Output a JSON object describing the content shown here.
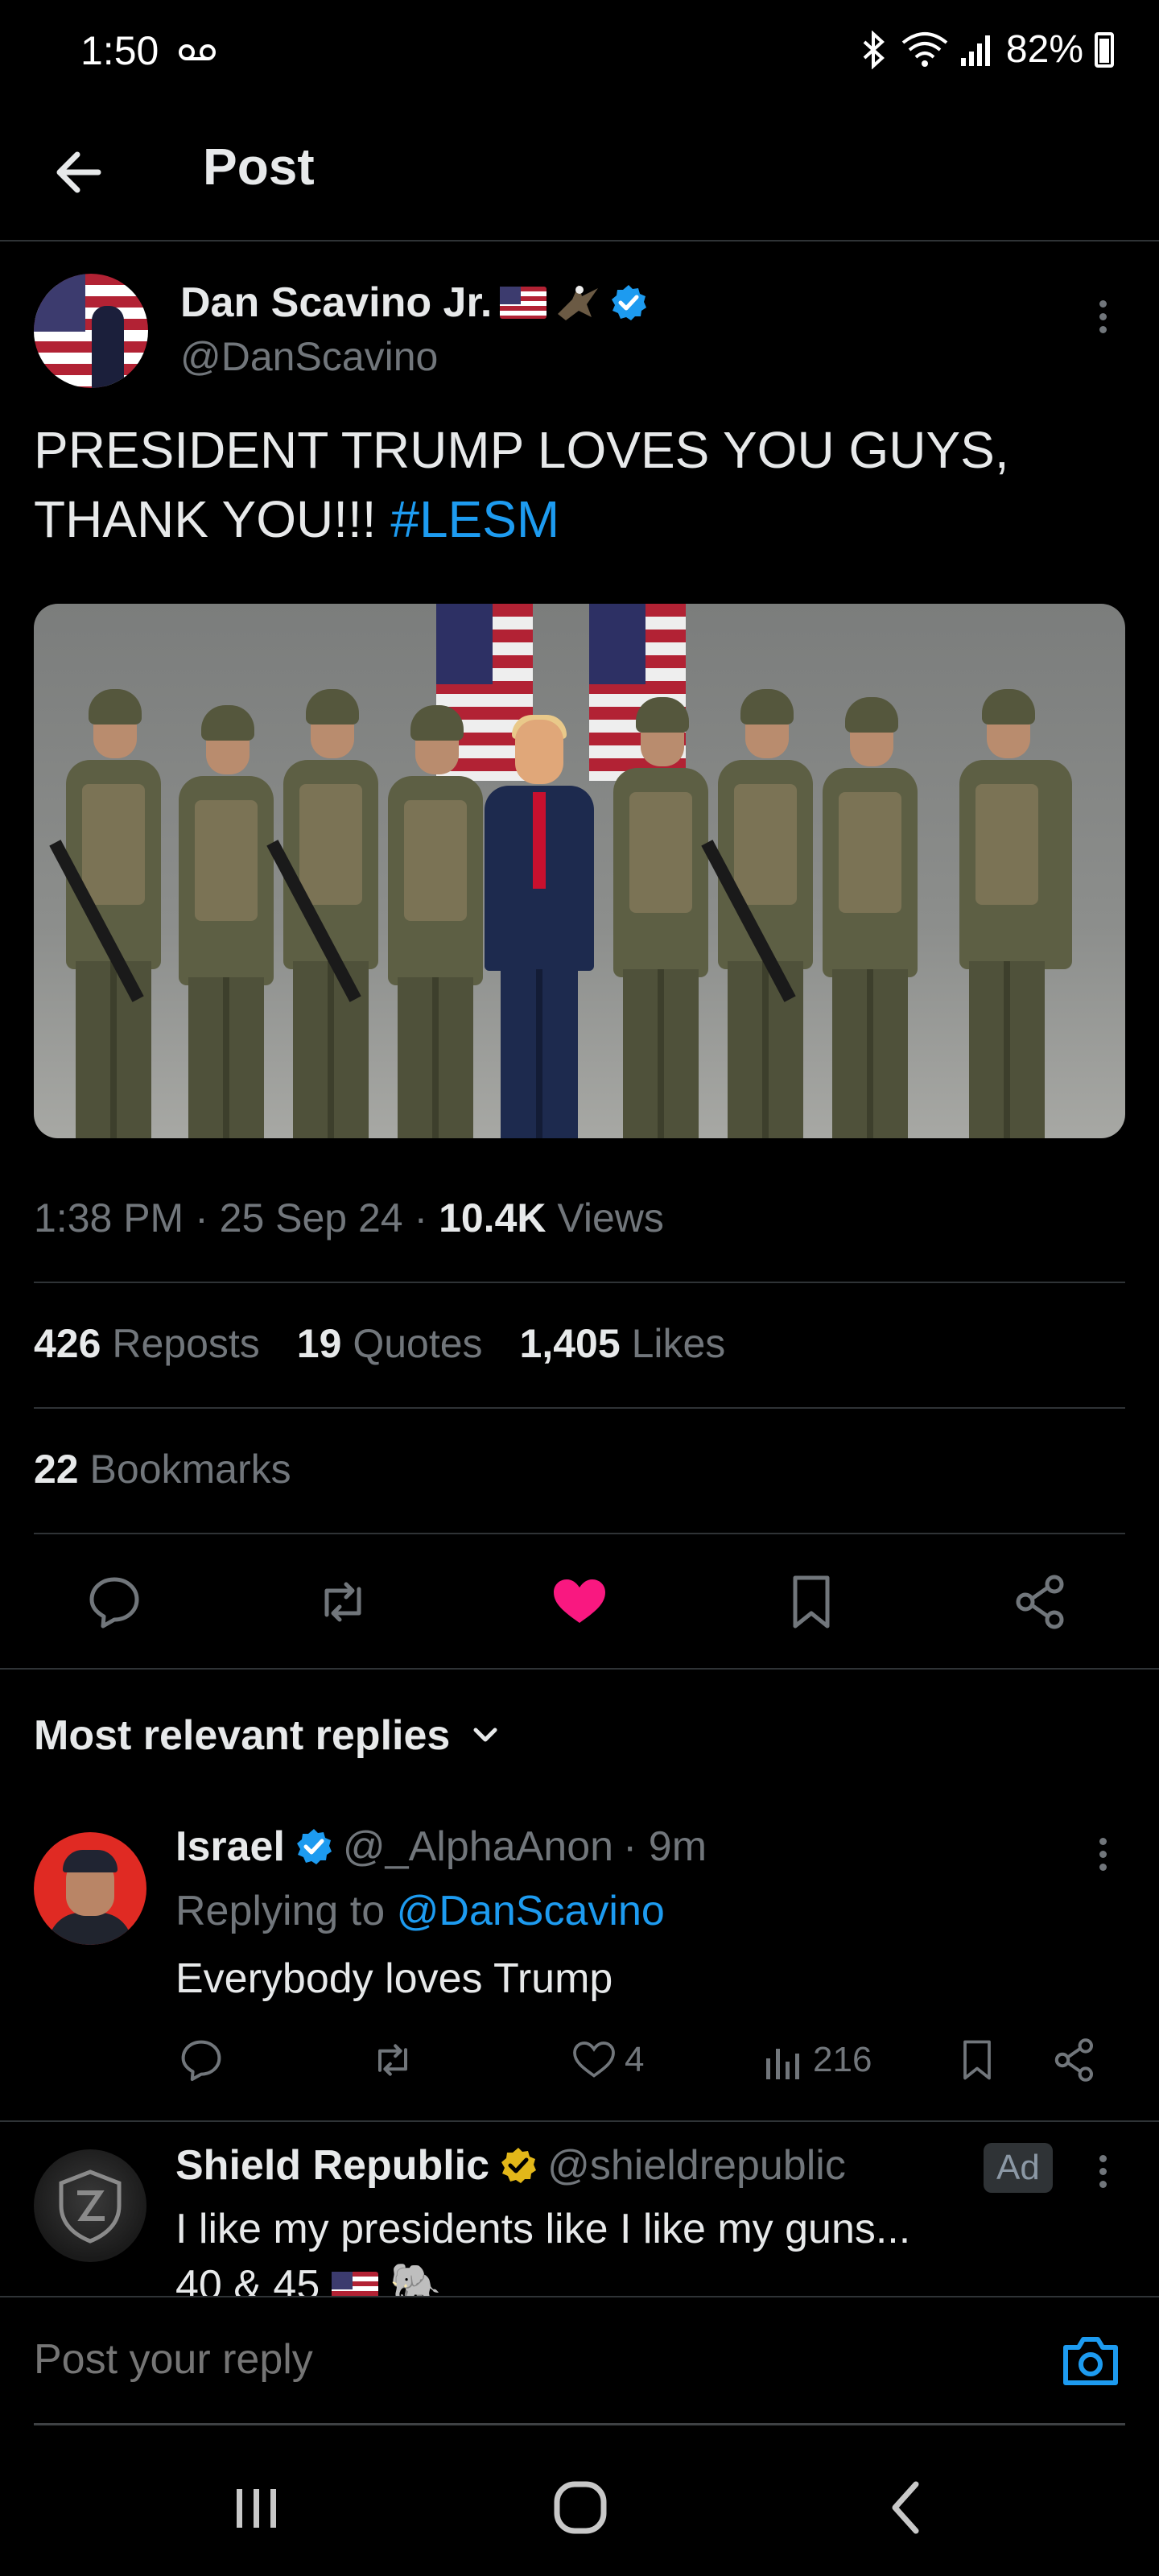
{
  "status_bar": {
    "time": "1:50",
    "battery": "82%"
  },
  "header": {
    "title": "Post"
  },
  "post": {
    "author_name": "Dan Scavino Jr.",
    "author_handle": "@DanScavino",
    "text": "PRESIDENT TRUMP LOVES YOU GUYS, THANK YOU!!! ",
    "hashtag": "#LESM",
    "timestamp": "1:38 PM · 25 Sep 24 · ",
    "views_count": "10.4K",
    "views_label": " Views",
    "reposts_count": "426",
    "reposts_label": "Reposts",
    "quotes_count": "19",
    "quotes_label": "Quotes",
    "likes_count": "1,405",
    "likes_label": "Likes",
    "bookmarks_count": "22",
    "bookmarks_label": "Bookmarks",
    "liked": true
  },
  "replies": {
    "sort_label": "Most relevant replies",
    "items": [
      {
        "name": "Israel",
        "handle": "@_AlphaAnon",
        "time": "· 9m",
        "replying_prefix": "Replying to ",
        "replying_to": "@DanScavino",
        "text": "Everybody loves Trump",
        "likes": "4",
        "views": "216"
      }
    ]
  },
  "ad": {
    "name": "Shield Republic",
    "handle": "@shieldrepublic",
    "badge": "Ad",
    "text": "I like my presidents like I like my guns...",
    "text2": "40 & 45"
  },
  "composer": {
    "placeholder": "Post your reply"
  },
  "colors": {
    "accent": "#1d9bf0",
    "like": "#f91880",
    "background": "#000000",
    "muted": "#71767b"
  }
}
